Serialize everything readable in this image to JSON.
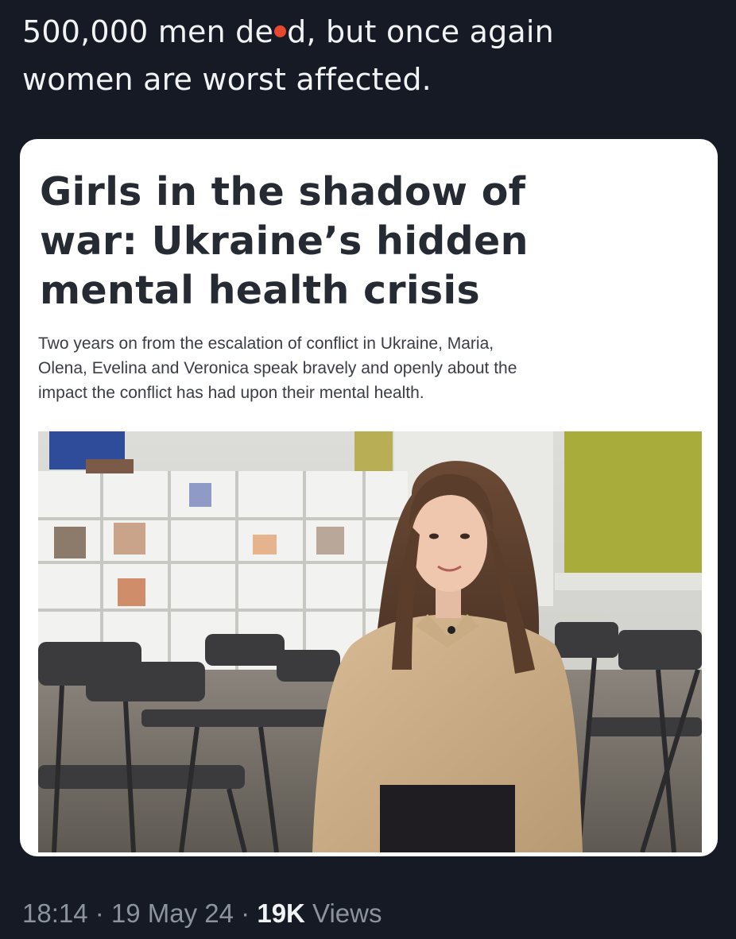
{
  "tweet": {
    "text_line1_before": "500,000 men de",
    "text_line1_after": "d, but once again",
    "text_line2": "women are worst affected."
  },
  "article": {
    "headline_lines": [
      "Girls in the shadow of",
      "war: Ukraine’s hidden",
      "mental health crisis"
    ],
    "dek_lines": [
      "Two years on from the escalation of conflict in Ukraine, Maria,",
      "Olena, Evelina and Veronica speak bravely and openly about the",
      "impact the conflict has had upon their mental health."
    ]
  },
  "meta": {
    "time": "18:14",
    "separator": " · ",
    "date": "19 May 24",
    "views_count": "19K",
    "views_label": " Views"
  },
  "colors": {
    "background": "#161a24",
    "card": "#ffffff",
    "headline": "#262a33",
    "meta_text": "#8b939c",
    "red_dot": "#e8482f"
  }
}
